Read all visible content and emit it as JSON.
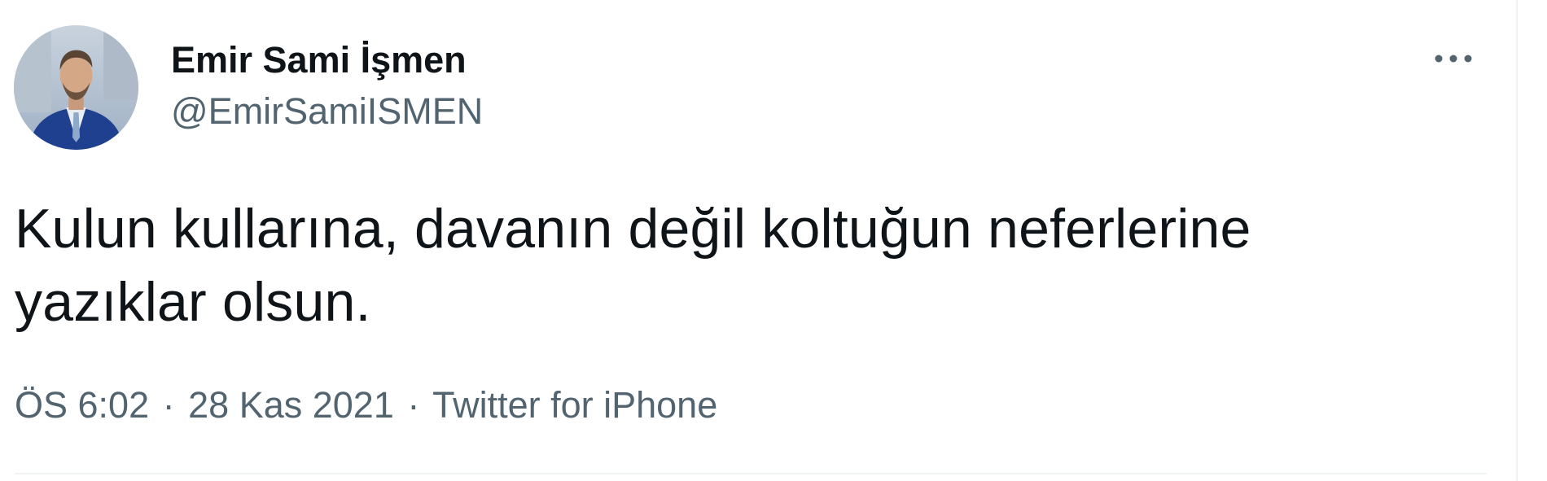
{
  "tweet": {
    "author": {
      "display_name": "Emir Sami İşmen",
      "handle": "@EmirSamiISMEN",
      "avatar_icon": "profile-photo"
    },
    "text": "Kulun kullarına, davanın değil koltuğun neferlerine yazıklar olsun.",
    "time": "ÖS 6:02",
    "date": "28 Kas 2021",
    "source": "Twitter for iPhone",
    "separator": "·",
    "more_icon": "more-horizontal-icon"
  },
  "colors": {
    "primary_text": "#0f1419",
    "secondary_text": "#536471",
    "divider": "#eff3f4"
  }
}
